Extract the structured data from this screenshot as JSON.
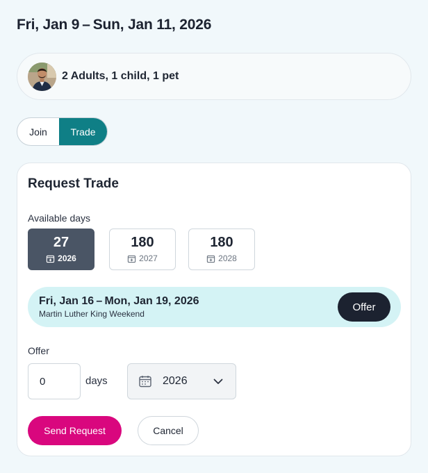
{
  "header": {
    "date_range": "Fri, Jan 9 – Sun, Jan 11, 2026"
  },
  "party": {
    "summary": "2 Adults, 1 child, 1 pet",
    "avatar_icon": "user-avatar-photo"
  },
  "mode_toggle": {
    "options": [
      {
        "label": "Join",
        "selected": false
      },
      {
        "label": "Trade",
        "selected": true
      }
    ]
  },
  "request_trade": {
    "title": "Request Trade",
    "available_label": "Available days",
    "available_days": [
      {
        "days": "27",
        "year": "2026",
        "selected": true
      },
      {
        "days": "180",
        "year": "2027",
        "selected": false
      },
      {
        "days": "180",
        "year": "2028",
        "selected": false
      }
    ],
    "offer_item": {
      "dates": "Fri, Jan 16 – Mon, Jan 19, 2026",
      "holiday": "Martin Luther King Weekend",
      "button_label": "Offer"
    },
    "offer_label": "Offer",
    "offer_days_value": "0",
    "offer_days_suffix": "days",
    "offer_year_value": "2026",
    "send_label": "Send Request",
    "cancel_label": "Cancel"
  },
  "colors": {
    "accent_teal": "#0f7f86",
    "send_pink": "#d9077e",
    "selected_day": "#4a5565",
    "banner_bg": "#d4f3f5",
    "dark_button": "#1c2230"
  },
  "icons": {
    "year_icon": "calendar-add-icon",
    "select_icon": "calendar-icon",
    "chevron": "chevron-down-icon"
  }
}
